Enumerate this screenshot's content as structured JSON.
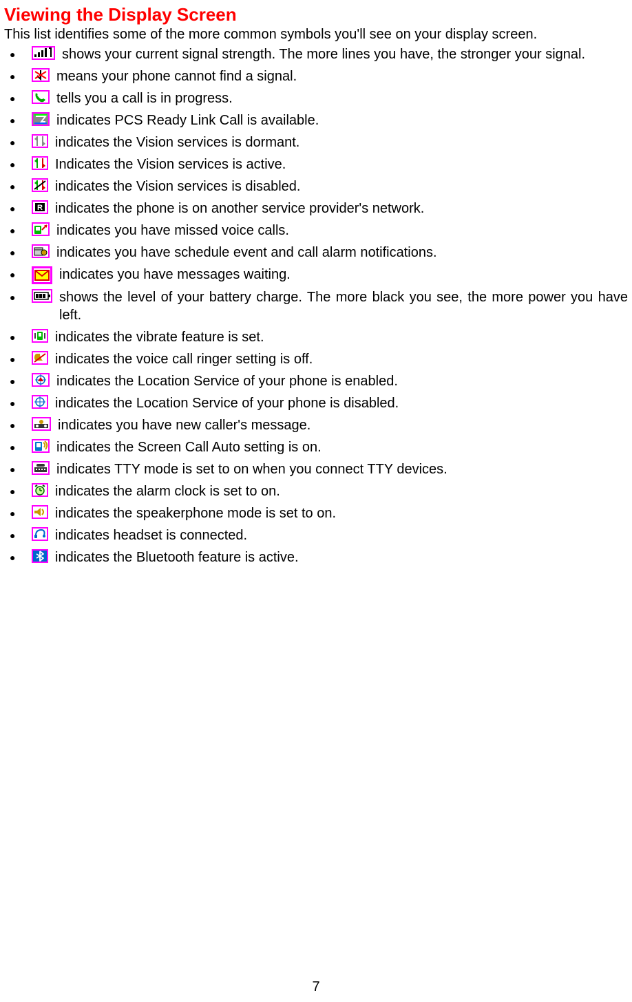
{
  "title": "Viewing the Display Screen",
  "intro": "This list identifies some of the more common symbols you'll see on your display screen.",
  "items": [
    {
      "text": " shows your current signal strength. The more lines you have, the stronger your signal."
    },
    {
      "text": "  means your phone cannot find a signal."
    },
    {
      "text": "  tells you a call is in progress."
    },
    {
      "text": "  indicates PCS Ready Link Call is available."
    },
    {
      "text": "  indicates the Vision services is dormant."
    },
    {
      "text": "  Indicates the Vision services is active."
    },
    {
      "text": "  indicates the Vision services is disabled."
    },
    {
      "text": "  indicates the phone is on another service provider's network."
    },
    {
      "text": " indicates you have missed voice calls."
    },
    {
      "text": "  indicates you have schedule event and call alarm notifications."
    },
    {
      "text": "  indicates you have messages waiting."
    },
    {
      "text": " shows the level of your battery charge. The more black you see, the more power you have left."
    },
    {
      "text": " indicates the vibrate feature is set."
    },
    {
      "text": " indicates the voice call ringer setting is off."
    },
    {
      "text": " indicates the Location Service of your phone is enabled."
    },
    {
      "text": "  indicates the Location Service of your phone is disabled."
    },
    {
      "text": " indicates you have new caller's message."
    },
    {
      "text": " indicates the Screen Call Auto setting is on."
    },
    {
      "text": "  indicates TTY mode is set to on when you connect TTY devices."
    },
    {
      "text": "  indicates the alarm clock is set to on."
    },
    {
      "text": "  indicates the speakerphone mode is set to on."
    },
    {
      "text": "  indicates headset is connected."
    },
    {
      "text": "  indicates the Bluetooth feature is active."
    }
  ],
  "page_number": "7"
}
